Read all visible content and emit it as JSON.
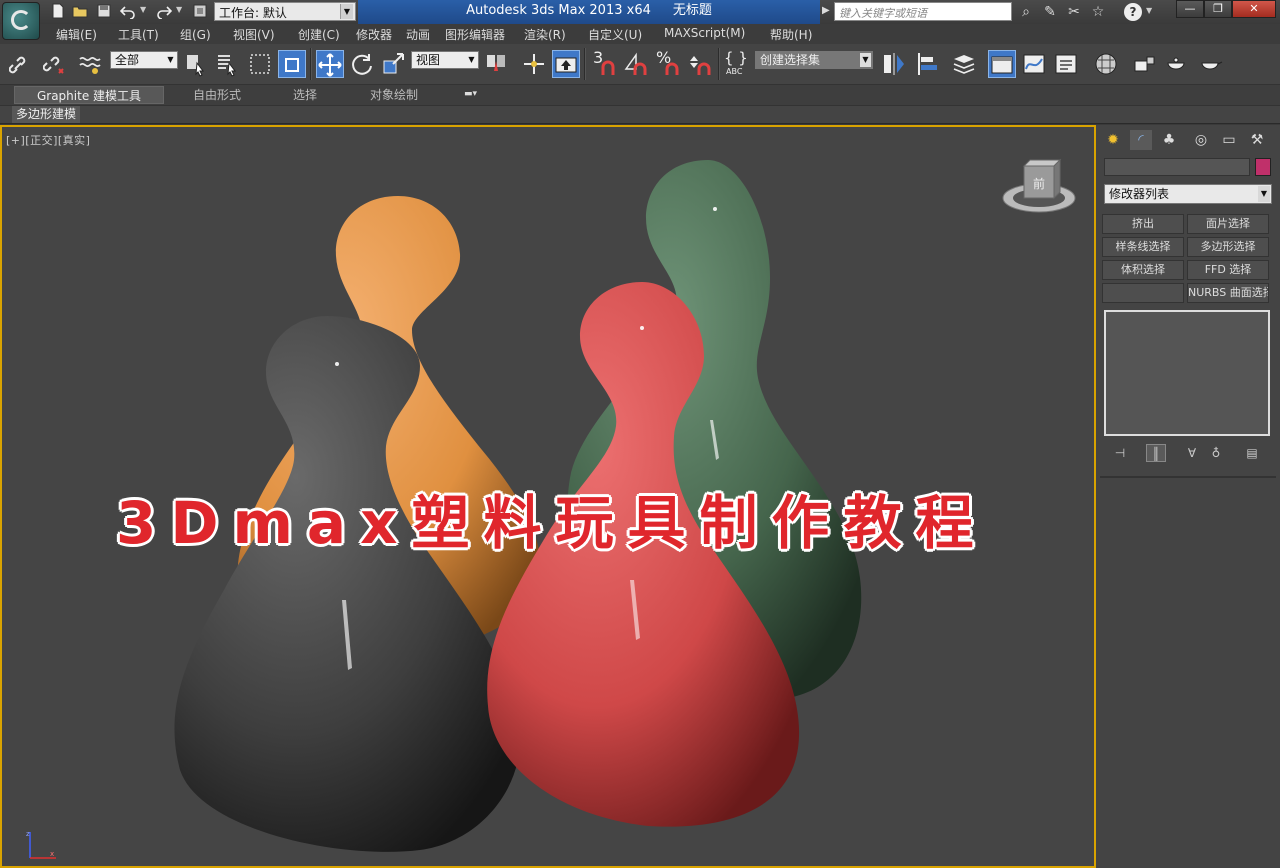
{
  "titlebar": {
    "workspace_label": "工作台: 默认",
    "app_title": "Autodesk 3ds Max  2013 x64",
    "doc_title": "无标题",
    "search_placeholder": "键入关键字或短语"
  },
  "menus": [
    "编辑(E)",
    "工具(T)",
    "组(G)",
    "视图(V)",
    "创建(C)",
    "修改器",
    "动画",
    "图形编辑器",
    "渲染(R)",
    "自定义(U)",
    "MAXScript(M)",
    "帮助(H)"
  ],
  "toolbar": {
    "selection_filter": "全部",
    "ref_coord": "视图",
    "snap_label": "3",
    "named_selection": "创建选择集"
  },
  "ribbon": {
    "tabs": [
      "Graphite 建模工具",
      "自由形式",
      "选择",
      "对象绘制"
    ],
    "subtab": "多边形建模"
  },
  "viewport": {
    "label": "[+][正交][真实]",
    "overlay_text": "3Dmax塑料玩具制作教程",
    "viewcube_label": "前",
    "objects": [
      {
        "name": "orange-pawn",
        "color": "#e8964a"
      },
      {
        "name": "green-pawn",
        "color": "#4a6b52"
      },
      {
        "name": "gray-pawn",
        "color": "#4a4a4a"
      },
      {
        "name": "red-pawn",
        "color": "#d04848"
      }
    ]
  },
  "command_panel": {
    "color_swatch": "#c0306a",
    "modifier_list": "修改器列表",
    "buttons": [
      "挤出",
      "面片选择",
      "样条线选择",
      "多边形选择",
      "体积选择",
      "FFD 选择",
      "",
      "NURBS 曲面选择"
    ]
  },
  "colors": {
    "accent": "#3f78c8",
    "viewport_border": "#d9a300",
    "overlay_text": "#e0262c"
  }
}
